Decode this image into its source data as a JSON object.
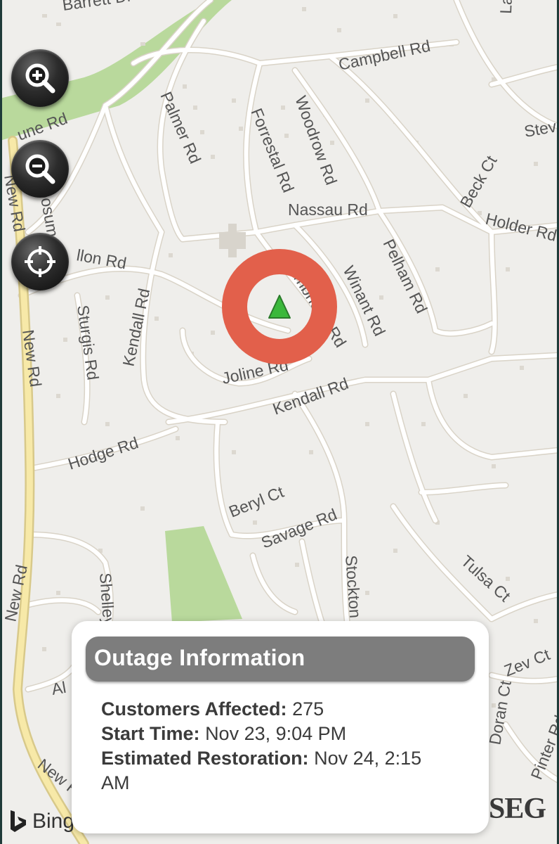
{
  "map": {
    "labels": {
      "barrett": "Barrett Dr",
      "lake": "La",
      "campbell": "Campbell Rd",
      "une": "une Rd",
      "palmer": "Palmer Rd",
      "forrestal": "Forrestal Rd",
      "woodrow": "Woodrow Rd",
      "stev": "Stev",
      "beck": "Beck Ct",
      "new_top": "New Rd",
      "posum": "posum",
      "nassau": "Nassau Rd",
      "holder": "Holder Rd",
      "pelham": "Pelham Rd",
      "dillon": "llon Rd",
      "cambridge": "Cambridge Rd",
      "winant": "Winant Rd",
      "kendall_v": "Kendall Rd",
      "sturgis": "Sturgis Rd",
      "new_mid": "New Rd",
      "joline": "Joline Rd",
      "kendall_h": "Kendall Rd",
      "hodge": "Hodge Rd",
      "beryl": "Beryl Ct",
      "savage": "Savage Rd",
      "stockton": "Stockton",
      "tulsa": "Tulsa Ct",
      "shelley": "Shelley",
      "new_low": "New Rd",
      "zev": "Zev Ct",
      "doran": "Doran Ct",
      "pinter": "Pinter Rd",
      "al": "Al",
      "new_bottom": "New Rd"
    },
    "controls": {
      "zoom_in_icon": "zoom-in-icon",
      "zoom_out_icon": "zoom-out-icon",
      "locate_icon": "crosshair-icon"
    },
    "marker": {
      "ring_color": "#e2604b",
      "triangle_color": "#3bb83b",
      "icon": "outage-triangle-icon"
    }
  },
  "outage": {
    "title": "Outage Information",
    "customers_label": "Customers Affected:",
    "customers_value": "275",
    "start_label": "Start Time:",
    "start_value": "Nov 23, 9:04 PM",
    "restoration_label": "Estimated Restoration:",
    "restoration_value": "Nov 24, 2:15 AM"
  },
  "branding": {
    "bing": "Bing",
    "pseg": "SEG"
  },
  "colors": {
    "map_bg": "#efeeeb",
    "road": "#ffffff",
    "road_edge": "#d9d3c7",
    "major_road": "#f7e9a8",
    "park": "#b9d99c",
    "header": "#7d7d7d"
  }
}
